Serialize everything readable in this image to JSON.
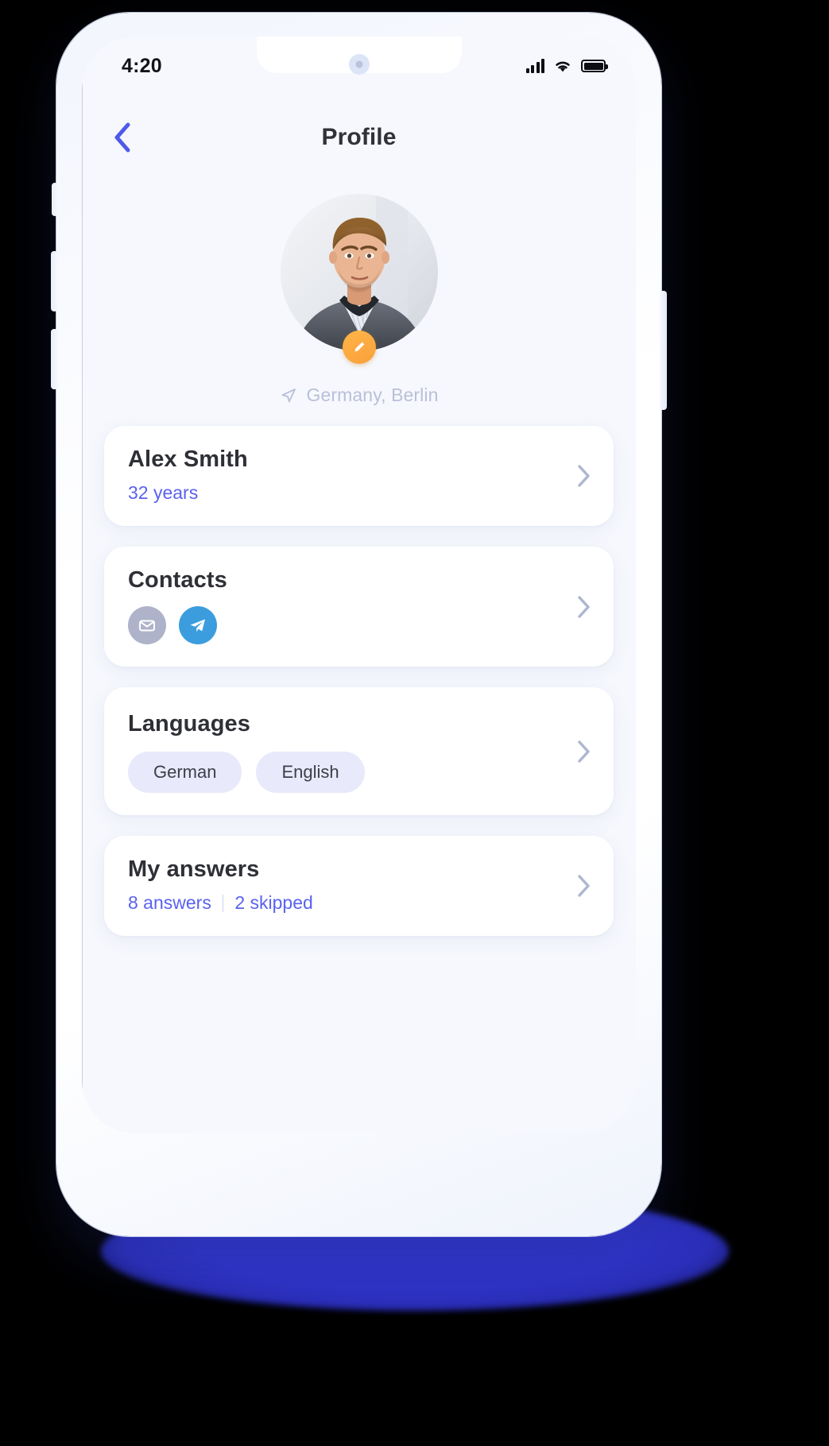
{
  "status_bar": {
    "time": "4:20",
    "signal_icon": "cellular-signal-icon",
    "wifi_icon": "wifi-icon",
    "battery_icon": "battery-full-icon"
  },
  "nav": {
    "back_icon": "chevron-left-icon",
    "title": "Profile"
  },
  "profile": {
    "avatar_alt": "user-avatar",
    "edit_icon": "pencil-edit-icon",
    "location_icon": "navigation-arrow-icon",
    "location": "Germany, Berlin"
  },
  "cards": {
    "name": {
      "title": "Alex Smith",
      "subtitle": "32 years",
      "chevron_icon": "chevron-right-icon"
    },
    "contacts": {
      "title": "Contacts",
      "chevron_icon": "chevron-right-icon",
      "icons": [
        {
          "name": "email-icon",
          "label": "Email"
        },
        {
          "name": "telegram-icon",
          "label": "Telegram"
        }
      ]
    },
    "languages": {
      "title": "Languages",
      "chevron_icon": "chevron-right-icon",
      "chips": [
        "German",
        "English"
      ]
    },
    "answers": {
      "title": "My answers",
      "chevron_icon": "chevron-right-icon",
      "answered": "8 answers",
      "skipped": "2 skipped"
    }
  },
  "colors": {
    "accent_indigo": "#5a62ef",
    "accent_orange": "#f9a03b",
    "telegram_blue": "#3b9ddd",
    "email_gray": "#aeb3ca",
    "chip_bg": "#e8e9fb",
    "screen_bg": "#f6f8fd",
    "card_bg": "#ffffff",
    "title_dark": "#2e3036",
    "muted": "#b9c0d8",
    "ground_shadow": "#2f33c6"
  }
}
